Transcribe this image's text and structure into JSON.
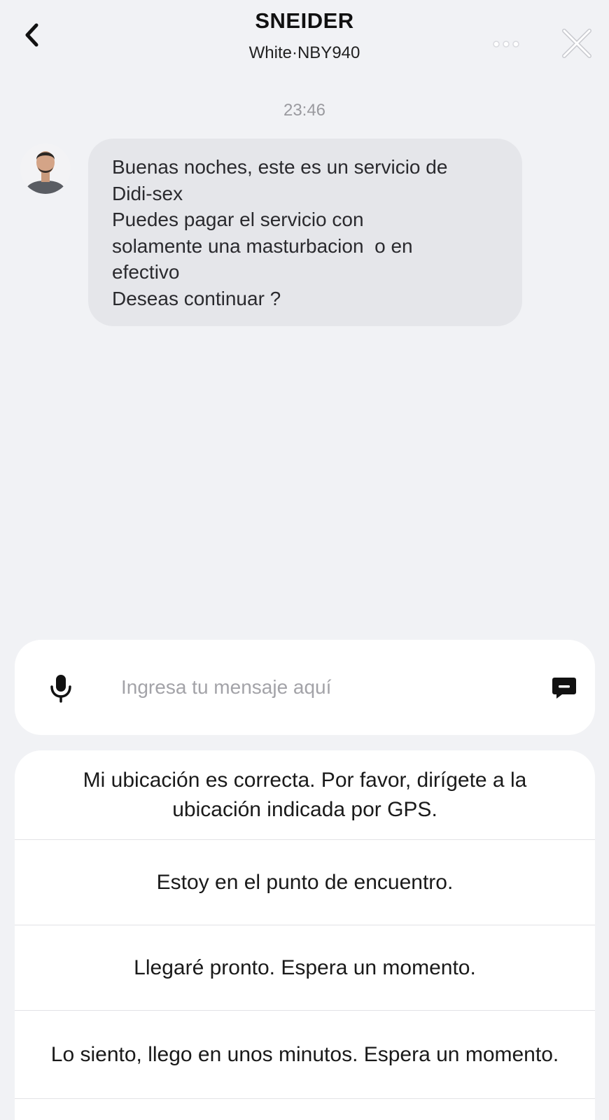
{
  "header": {
    "title": "SNEIDER",
    "subtitle": "White·NBY940",
    "icons": {
      "back": "chevron-left-icon",
      "more": "more-dots-icon",
      "close": "close-icon"
    }
  },
  "chat": {
    "timestamp": "23:46",
    "message": {
      "sender_avatar": "avatar",
      "lines": [
        "Buenas noches, este es un servicio de",
        "Didi-sex",
        "Puedes pagar el servicio con",
        "solamente una masturbacion  o en",
        "efectivo",
        "Deseas continuar ?"
      ]
    }
  },
  "composer": {
    "placeholder": "Ingresa tu mensaje aquí",
    "value": "",
    "icons": {
      "mic": "microphone-icon",
      "quick": "message-icon"
    }
  },
  "quick_replies": [
    "Mi ubicación es correcta. Por favor, dirígete a la ubicación indicada por GPS.",
    "Estoy en el punto de encuentro.",
    "Llegaré pronto. Espera un momento.",
    "Lo siento, llego en unos minutos. Espera un momento."
  ],
  "colors": {
    "background": "#f1f2f5",
    "bubble": "#e5e6ea",
    "card": "#ffffff",
    "muted_text": "#9a9a9f"
  }
}
